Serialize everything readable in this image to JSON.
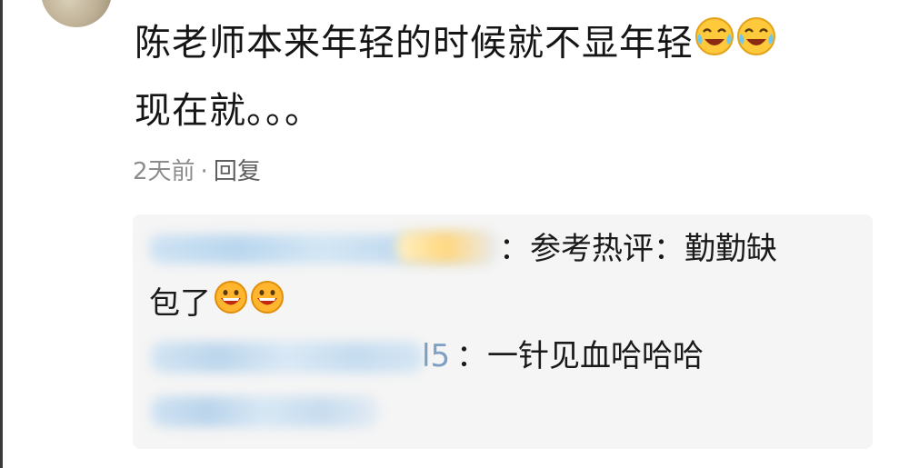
{
  "comment": {
    "line1": "陈老师本来年轻的时候就不显年轻",
    "line2": "现在就。。。",
    "emoji_icons": [
      "laughing-tears-icon",
      "laughing-tears-icon"
    ]
  },
  "meta": {
    "time": "2天前",
    "separator": "·",
    "reply_label": "回复"
  },
  "replies": [
    {
      "author_visible_suffix": "",
      "text": "：参考热评：勤勤缺",
      "text_cont": "包了",
      "emoji_icons": [
        "grin-icon",
        "grin-icon"
      ]
    },
    {
      "author_visible_suffix": "l5",
      "text": "：一针见血哈哈哈"
    },
    {
      "author_visible_suffix": "",
      "text": ""
    }
  ],
  "colors": {
    "reply_bg": "#f5f5f5",
    "meta_text": "#8c8c8c",
    "main_text": "#151515"
  }
}
